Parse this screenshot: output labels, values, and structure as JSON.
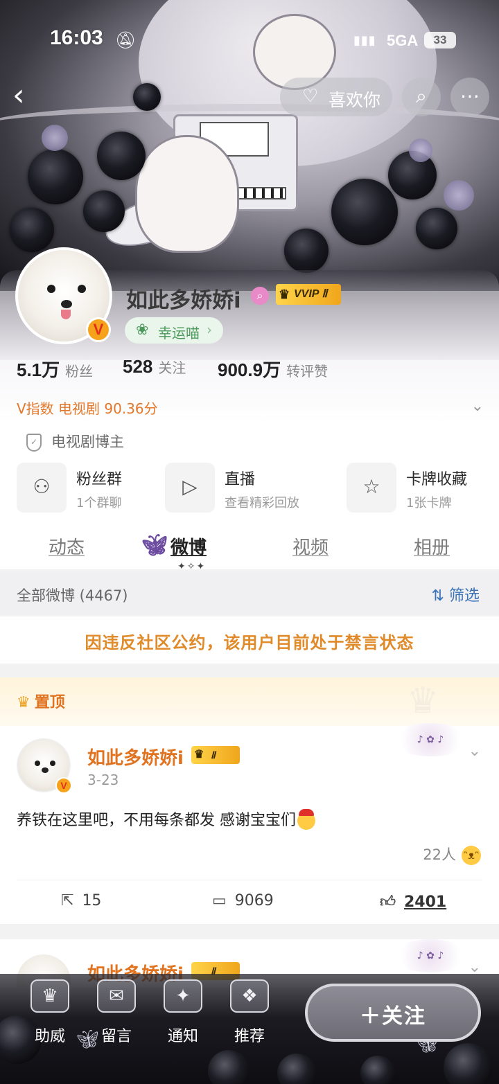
{
  "status_bar": {
    "time": "16:03",
    "mute_icon": "bell-off-icon",
    "network": "5GA",
    "battery": "33"
  },
  "header": {
    "like_label": "喜欢你"
  },
  "profile": {
    "username": "如此多娇娇i",
    "vip_badge": "VVIP Ⅱ",
    "lucky_label": "幸运喵",
    "stats": [
      {
        "value": "5.1万",
        "label": "粉丝"
      },
      {
        "value": "528",
        "label": "关注"
      },
      {
        "value": "900.9万",
        "label": "转评赞"
      }
    ],
    "v_index": "V指数 电视剧 90.36分",
    "certification": "电视剧博主"
  },
  "features": [
    {
      "title": "粉丝群",
      "subtitle": "1个群聊",
      "icon": "people-icon"
    },
    {
      "title": "直播",
      "subtitle": "查看精彩回放",
      "icon": "tv-icon"
    },
    {
      "title": "卡牌收藏",
      "subtitle": "1张卡牌",
      "icon": "card-icon"
    }
  ],
  "tabs": [
    "动态",
    "微博",
    "视频",
    "相册"
  ],
  "active_tab": "微博",
  "filter_bar": {
    "all_label": "全部微博 (4467)",
    "filter_label": "筛选"
  },
  "banned_notice": "因违反社区公约，该用户目前处于禁言状态",
  "pinned_post": {
    "pinned_label": "置顶",
    "author": "如此多娇娇i",
    "badge": "Ⅱ",
    "date": "3-23",
    "text": "养铁在这里吧，不用每条都发 感谢宝宝们",
    "reactions": "22人",
    "reposts": "15",
    "comments": "9069",
    "likes": "2401"
  },
  "next_post": {
    "author": "如此多娇娇i",
    "badge": "Ⅱ"
  },
  "bottom_bar": {
    "items": [
      "助威",
      "留言",
      "通知",
      "推荐"
    ],
    "follow_label": "＋关注"
  },
  "colors": {
    "accent_orange": "#e0731f",
    "link_blue": "#3a73b8",
    "vip_gold": "#f0a61c"
  }
}
